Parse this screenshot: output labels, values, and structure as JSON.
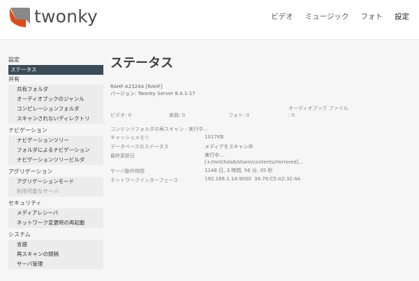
{
  "header": {
    "logo_text": "twonky",
    "nav": [
      "ビデオ",
      "ミュージック",
      "フォト",
      "設定"
    ]
  },
  "sidebar": {
    "sections": [
      {
        "title": "設定",
        "items": [
          {
            "label": "ステータス"
          }
        ]
      },
      {
        "title": "共有",
        "items": [
          {
            "label": "共有フォルダ"
          },
          {
            "label": "オーディオブックのジャンル"
          },
          {
            "label": "コンピレーションフォルダ"
          },
          {
            "label": "スキャンされないディレクトリ"
          }
        ]
      },
      {
        "title": "ナビゲーション",
        "items": [
          {
            "label": "ナビゲーションツリー"
          },
          {
            "label": "フォルダによるナビゲーション"
          },
          {
            "label": "ナビゲーションツリービルダ"
          }
        ]
      },
      {
        "title": "アグリゲーション",
        "items": [
          {
            "label": "アグリゲーションモード"
          },
          {
            "label": "利用可能なサーバ"
          }
        ]
      },
      {
        "title": "セキュリティ",
        "items": [
          {
            "label": "メディアレシーバ"
          },
          {
            "label": "ネットワーク変更時の再起動"
          }
        ]
      },
      {
        "title": "システム",
        "items": [
          {
            "label": "言語"
          },
          {
            "label": "再スキャンの間隔"
          },
          {
            "label": "サーバ管理"
          }
        ]
      }
    ]
  },
  "status": {
    "title": "ステータス",
    "device": "RAHF-A2324A [RAHF]",
    "version": "バージョン: Twonky Server 8.4.1-17",
    "counts": {
      "video": "ビデオ: 0",
      "music": "楽曲: 0",
      "photo": "フォト: 0",
      "audiobook_label": "オーディオブック ファイル",
      "audiobook_value": ": 0"
    },
    "rescan": "コンテンツフォルダの再スキャン - 実行中...",
    "cache_label": "キャッシュメモリ",
    "cache_value": "1017KB",
    "db_label": "データベースのステータス",
    "db_value": "メディアをスキャン中",
    "last_update_label": "最終更新日",
    "last_update_value1": "実行中...",
    "last_update_value2": "[+/mnt/hda6/share/contents/mirrored]...",
    "uptime_label": "サーバ動作時間",
    "uptime_value": "1148 日, 3 時間, 56 分, 35 秒",
    "nic_label": "ネットワークインターフェース",
    "nic_ip": "192.168.1.14:9000",
    "nic_mac": "34:76:C5:A2:32:4A"
  }
}
